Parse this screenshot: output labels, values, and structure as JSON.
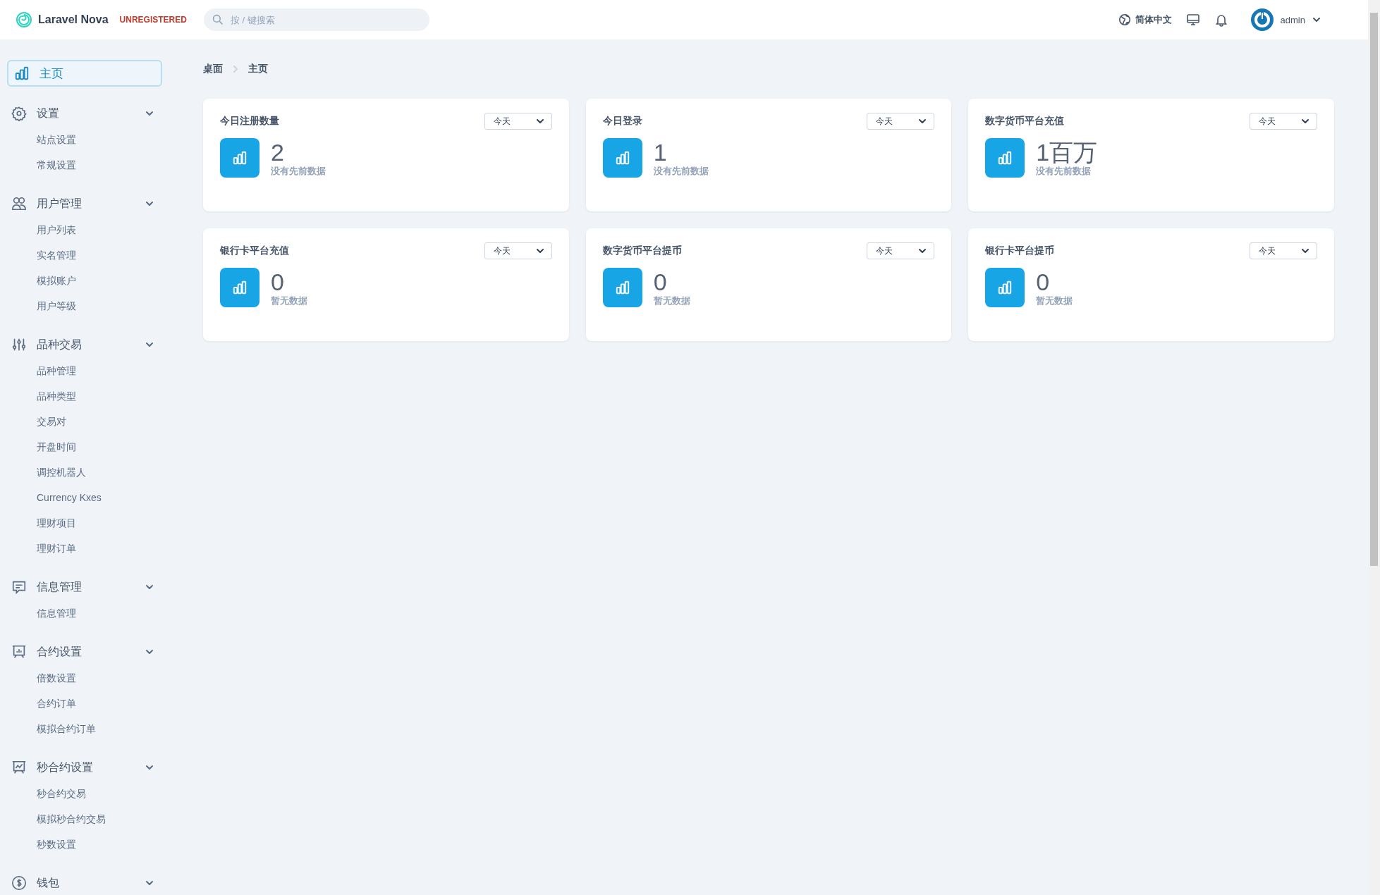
{
  "header": {
    "brand": "Laravel Nova",
    "license_badge": "UNREGISTERED",
    "search": {
      "placeholder": "按 / 键搜索"
    },
    "language": "简体中文",
    "user": "admin"
  },
  "sidebar": {
    "home": {
      "label": "主页",
      "selected": true
    },
    "groups": [
      {
        "label": "设置",
        "expanded": true,
        "items": [
          "站点设置",
          "常规设置"
        ]
      },
      {
        "label": "用户管理",
        "expanded": true,
        "items": [
          "用户列表",
          "实名管理",
          "模拟账户",
          "用户等级"
        ]
      },
      {
        "label": "品种交易",
        "expanded": true,
        "items": [
          "品种管理",
          "品种类型",
          "交易对",
          "开盘时间",
          "调控机器人",
          "Currency Kxes",
          "理财项目",
          "理财订单"
        ]
      },
      {
        "label": "信息管理",
        "expanded": true,
        "items": [
          "信息管理"
        ]
      },
      {
        "label": "合约设置",
        "expanded": true,
        "items": [
          "倍数设置",
          "合约订单",
          "模拟合约订单"
        ]
      },
      {
        "label": "秒合约设置",
        "expanded": true,
        "items": [
          "秒合约交易",
          "模拟秒合约交易",
          "秒数设置"
        ]
      },
      {
        "label": "钱包",
        "expanded": true
      }
    ]
  },
  "breadcrumb": [
    "桌面",
    "主页"
  ],
  "metrics": [
    {
      "title": "今日注册数量",
      "range": "今天",
      "value": "2",
      "note": "没有先前数据"
    },
    {
      "title": "今日登录",
      "range": "今天",
      "value": "1",
      "note": "没有先前数据"
    },
    {
      "title": "数字货币平台充值",
      "range": "今天",
      "value": "1百万",
      "note": "没有先前数据"
    },
    {
      "title": "银行卡平台充值",
      "range": "今天",
      "value": "0",
      "note": "暂无数据"
    },
    {
      "title": "数字货币平台提币",
      "range": "今天",
      "value": "0",
      "note": "暂无数据"
    },
    {
      "title": "银行卡平台提币",
      "range": "今天",
      "value": "0",
      "note": "暂无数据"
    }
  ]
}
